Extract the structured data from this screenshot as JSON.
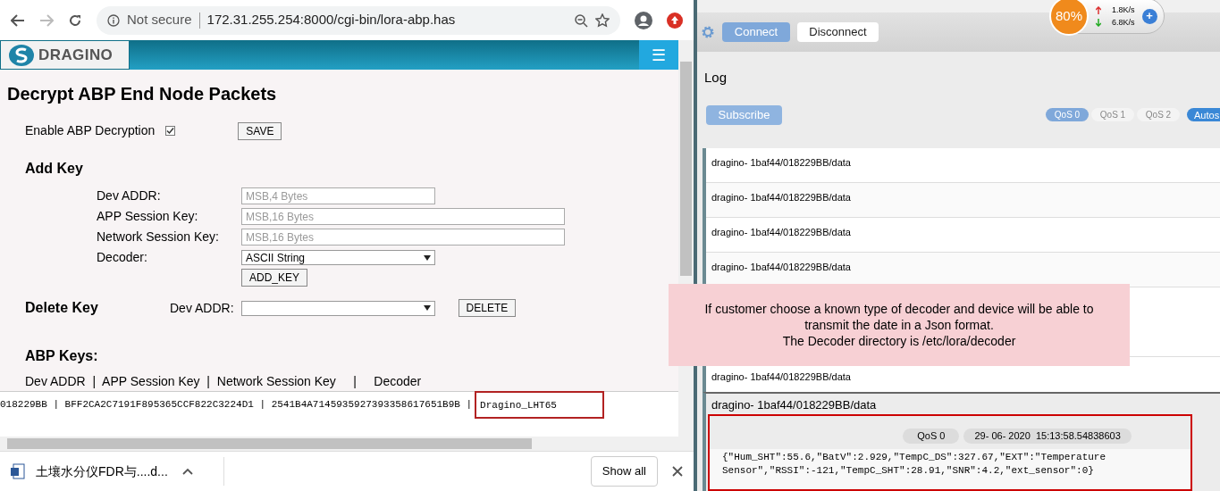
{
  "browser": {
    "security": "Not secure",
    "url": "172.31.255.254:8000/cgi-bin/lora-abp.has",
    "download": "土壤水分仪FDR与....d...",
    "show_all": "Show all"
  },
  "header": {
    "logo": "DRAGINO",
    "menu": "☰"
  },
  "page": {
    "title": "Decrypt ABP End Node Packets",
    "enable_label": "Enable ABP Decryption",
    "enable_checked": true,
    "save": "SAVE",
    "add_key": {
      "title": "Add Key",
      "fields": [
        {
          "label": "Dev ADDR:",
          "kind": "input",
          "placeholder": "MSB,4 Bytes",
          "wide": false
        },
        {
          "label": "APP Session Key:",
          "kind": "input",
          "placeholder": "MSB,16 Bytes",
          "wide": true
        },
        {
          "label": "Network Session Key:",
          "kind": "input",
          "placeholder": "MSB,16 Bytes",
          "wide": true
        },
        {
          "label": "Decoder:",
          "kind": "select",
          "value": "ASCII String",
          "wide": false
        }
      ],
      "button": "ADD_KEY"
    },
    "delete_key": {
      "title": "Delete Key",
      "label": "Dev ADDR:",
      "button": "DELETE"
    },
    "abp_keys": {
      "title": "ABP Keys:",
      "header": "Dev ADDR  |  APP Session Key  |  Network Session Key     |     Decoder",
      "row": "018229BB | BFF2CA2C7191F895365CCF822C3224D1 | 2541B4A7145935927393358617651B9B |",
      "decoder": "Dragino_LHT65"
    }
  },
  "mqtt": {
    "connect": "Connect",
    "disconnect": "Disconnect",
    "log": "Log",
    "subscribe": "Subscribe",
    "qos": [
      {
        "label": "QoS 0",
        "selected": true
      },
      {
        "label": "QoS 1",
        "selected": false
      },
      {
        "label": "QoS 2",
        "selected": false
      }
    ],
    "autoscroll": "Autos",
    "rows_above": [
      "dragino- 1baf44/018229BB/data",
      "dragino- 1baf44/018229BB/data",
      "dragino- 1baf44/018229BB/data",
      "dragino- 1baf44/018229BB/data"
    ],
    "rows_below": [
      "dragino- 1baf44/018229BB/data"
    ],
    "detail": {
      "topic": "dragino- 1baf44/018229BB/data",
      "qos": "QoS 0",
      "time": "29- 06- 2020  15:13:58.54838603",
      "payload": "{\"Hum_SHT\":55.6,\"BatV\":2.929,\"TempC_DS\":327.67,\"EXT\":\"Temperature Sensor\",\"RSSI\":-121,\"TempC_SHT\":28.91,\"SNR\":4.2,\"ext_sensor\":0}"
    }
  },
  "speed": {
    "percent": "80%",
    "up": "1.8K/s",
    "down": "6.8K/s",
    "plus": "+"
  },
  "callout": {
    "lines": [
      "If customer choose a known type of decoder and device will be able to transmit the date in a Json format.",
      "The Decoder directory is /etc/lora/decoder"
    ]
  }
}
